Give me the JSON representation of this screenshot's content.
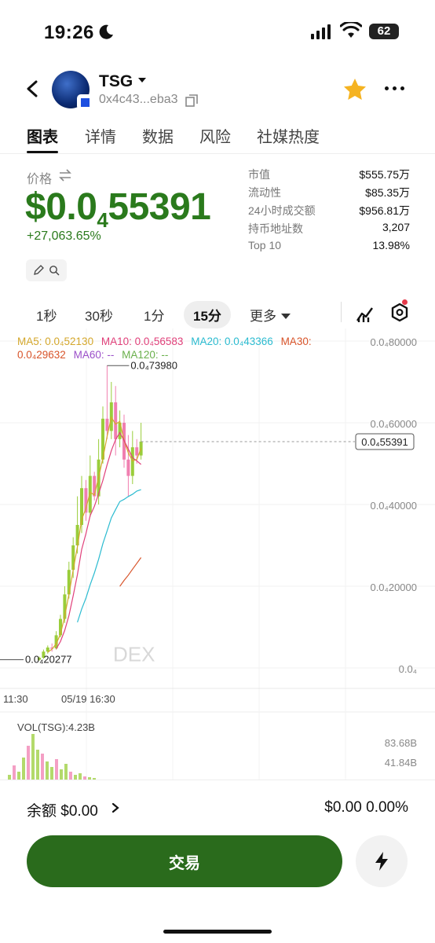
{
  "status": {
    "time": "19:26",
    "battery": "62"
  },
  "header": {
    "token_name": "TSG",
    "address": "0x4c43...eba3"
  },
  "tabs": [
    "图表",
    "详情",
    "数据",
    "风险",
    "社媒热度"
  ],
  "price": {
    "label": "价格",
    "main": "$0.0",
    "sub": "4",
    "rest": "55391",
    "change": "+27,063.65%"
  },
  "stats": [
    {
      "k": "市值",
      "v": "$555.75万"
    },
    {
      "k": "流动性",
      "v": "$85.35万"
    },
    {
      "k": "24小时成交额",
      "v": "$956.81万"
    },
    {
      "k": "持币地址数",
      "v": "3,207"
    },
    {
      "k": "Top 10",
      "v": "13.98%"
    }
  ],
  "intervals": {
    "i1": "1秒",
    "i2": "30秒",
    "i3": "1分",
    "i4": "15分",
    "more": "更多"
  },
  "ma_legend": {
    "ma5": "MA5: 0.0₄52130",
    "ma10": "MA10: 0.0₄56583",
    "ma20": "MA20: 0.0₄43366",
    "ma30": "MA30: 0.0₄29632",
    "ma60": "MA60: --",
    "ma120": "MA120: --"
  },
  "colors": {
    "up": "#9acd3a",
    "down": "#f07fb0",
    "ma5": "#d4a72c",
    "ma10": "#e0407a",
    "ma20": "#2bbbd0",
    "ma30": "#d8542a",
    "ma60": "#9b4fc9",
    "ma120": "#6ab04c",
    "brand_green": "#2a7a1c"
  },
  "chart_data": {
    "type": "candlestick",
    "y_ticks": [
      "0.0₄80000",
      "0.0₄60000",
      "0.0₄40000",
      "0.0₄20000",
      "0.0₄"
    ],
    "y_values": [
      0.8,
      0.6,
      0.4,
      0.2,
      0.0
    ],
    "x_ticks": [
      "11:30",
      "05/19 16:30"
    ],
    "high_label": "0.0₄73980",
    "low_label": "0.0₄20277",
    "current_label": "0.0₄55391",
    "watermark": "DEX",
    "volume_label": "VOL(TSG):4.23B",
    "volume_ticks": [
      "83.68B",
      "41.84B"
    ],
    "candles": [
      {
        "o": 0.02,
        "c": 0.025,
        "h": 0.028,
        "l": 0.018
      },
      {
        "o": 0.025,
        "c": 0.04,
        "h": 0.045,
        "l": 0.022
      },
      {
        "o": 0.04,
        "c": 0.05,
        "h": 0.055,
        "l": 0.035
      },
      {
        "o": 0.05,
        "c": 0.048,
        "h": 0.06,
        "l": 0.04
      },
      {
        "o": 0.048,
        "c": 0.08,
        "h": 0.09,
        "l": 0.045
      },
      {
        "o": 0.08,
        "c": 0.12,
        "h": 0.13,
        "l": 0.075
      },
      {
        "o": 0.12,
        "c": 0.18,
        "h": 0.2,
        "l": 0.11
      },
      {
        "o": 0.18,
        "c": 0.24,
        "h": 0.26,
        "l": 0.17
      },
      {
        "o": 0.24,
        "c": 0.3,
        "h": 0.32,
        "l": 0.22
      },
      {
        "o": 0.3,
        "c": 0.35,
        "h": 0.42,
        "l": 0.28
      },
      {
        "o": 0.35,
        "c": 0.44,
        "h": 0.47,
        "l": 0.33
      },
      {
        "o": 0.44,
        "c": 0.38,
        "h": 0.46,
        "l": 0.36
      },
      {
        "o": 0.38,
        "c": 0.47,
        "h": 0.52,
        "l": 0.37
      },
      {
        "o": 0.47,
        "c": 0.42,
        "h": 0.48,
        "l": 0.41
      },
      {
        "o": 0.42,
        "c": 0.51,
        "h": 0.56,
        "l": 0.4
      },
      {
        "o": 0.51,
        "c": 0.61,
        "h": 0.64,
        "l": 0.5
      },
      {
        "o": 0.61,
        "c": 0.58,
        "h": 0.74,
        "l": 0.56
      },
      {
        "o": 0.58,
        "c": 0.65,
        "h": 0.7,
        "l": 0.56
      },
      {
        "o": 0.65,
        "c": 0.56,
        "h": 0.69,
        "l": 0.52
      },
      {
        "o": 0.56,
        "c": 0.6,
        "h": 0.63,
        "l": 0.54
      },
      {
        "o": 0.6,
        "c": 0.51,
        "h": 0.62,
        "l": 0.49
      },
      {
        "o": 0.51,
        "c": 0.47,
        "h": 0.57,
        "l": 0.42
      },
      {
        "o": 0.47,
        "c": 0.54,
        "h": 0.58,
        "l": 0.45
      },
      {
        "o": 0.54,
        "c": 0.52,
        "h": 0.56,
        "l": 0.5
      },
      {
        "o": 0.52,
        "c": 0.554,
        "h": 0.6,
        "l": 0.51
      }
    ],
    "volumes": [
      2,
      8,
      20,
      12,
      30,
      45,
      60,
      40,
      35,
      25,
      18,
      28,
      15,
      22,
      12,
      8,
      10,
      6,
      5,
      4
    ]
  },
  "bottom": {
    "balance": "余额 $0.00",
    "amount": "$0.00",
    "percent": "0.00%",
    "trade": "交易"
  }
}
